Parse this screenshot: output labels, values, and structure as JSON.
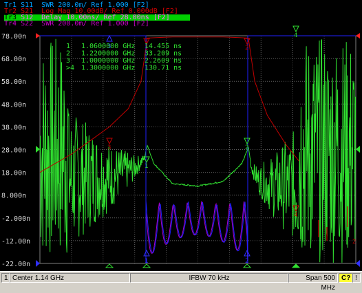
{
  "traces": [
    {
      "label": "Tr1",
      "text": "S11  SWR 200.0m/ Ref 1.000 [F2]",
      "color": "#00a0ff",
      "active": false
    },
    {
      "label": "Tr2",
      "text": "S21  Log Mag 10.00dB/ Ref 0.000dB [F2]",
      "color": "#d00000",
      "active": false
    },
    {
      "label": "Tr3",
      "text": "S12  Delay 10.00ns/ Ref 28.00ns [F2]",
      "color": "#ff66ff",
      "active": true
    },
    {
      "label": "Tr4",
      "text": "S22  SWR 200.0m/ Ref 1.000 [F2]",
      "color": "#cc00cc",
      "active": false
    }
  ],
  "y_axis_labels": [
    "78.00n",
    "68.00n",
    "58.00n",
    "48.00n",
    "38.00n",
    "28.00n",
    "18.00n",
    "8.000n",
    "-2.000n",
    "-12.00n",
    "-22.00n"
  ],
  "marker_table": [
    {
      "id": "1",
      "freq": "1.0600000 GHz",
      "value": "14.455 ns"
    },
    {
      "id": "2",
      "freq": "1.2200000 GHz",
      "value": "33.209 ns"
    },
    {
      "id": "3",
      "freq": "1.0000000 GHz",
      "value": "2.2609 ns"
    },
    {
      "id": ">4",
      "freq": "1.3000000 GHz",
      "value": "130.71 ns"
    }
  ],
  "marker_labels": [
    "1",
    "2",
    "3",
    "4"
  ],
  "status": {
    "channel": "1",
    "center": "Center 1.14 GHz",
    "ifbw": "IFBW 70 kHz",
    "span": "Span 500 MHz",
    "cal": "C?",
    "extra": "!"
  },
  "colors": {
    "s11": "#2020ff",
    "s21": "#c00000",
    "s12": "#30e030",
    "s22": "#aa00cc",
    "grid": "#606060"
  },
  "chart_data": {
    "type": "line",
    "xlabel": "",
    "ylabel": "",
    "x_range_ghz": [
      0.89,
      1.39
    ],
    "center": "1.14 GHz",
    "span": "500 MHz",
    "ylim_delay_ns": [
      -22,
      78
    ],
    "series": [
      {
        "name": "Tr3",
        "trace": "S12 Delay",
        "x": [
          0.89,
          0.98,
          1.0,
          1.02,
          1.04,
          1.055,
          1.06,
          1.07,
          1.1,
          1.14,
          1.18,
          1.21,
          1.22,
          1.225,
          1.235,
          1.26,
          1.3,
          1.39
        ],
        "values": [
          15,
          16,
          16,
          18,
          20,
          24,
          30,
          22,
          13,
          12,
          14,
          22,
          29,
          20,
          15,
          12,
          12,
          12
        ]
      },
      {
        "name": "Tr2",
        "trace": "S21 Log Mag",
        "x": [
          0.89,
          0.94,
          0.97,
          1.0,
          1.03,
          1.05,
          1.06,
          1.1,
          1.14,
          1.18,
          1.22,
          1.23,
          1.25,
          1.28,
          1.3
        ],
        "values": [
          -60,
          -52,
          -46,
          -40,
          -32,
          -20,
          -1,
          -0.5,
          -0.5,
          -0.5,
          -1,
          -20,
          -35,
          -48,
          -55
        ]
      }
    ]
  }
}
